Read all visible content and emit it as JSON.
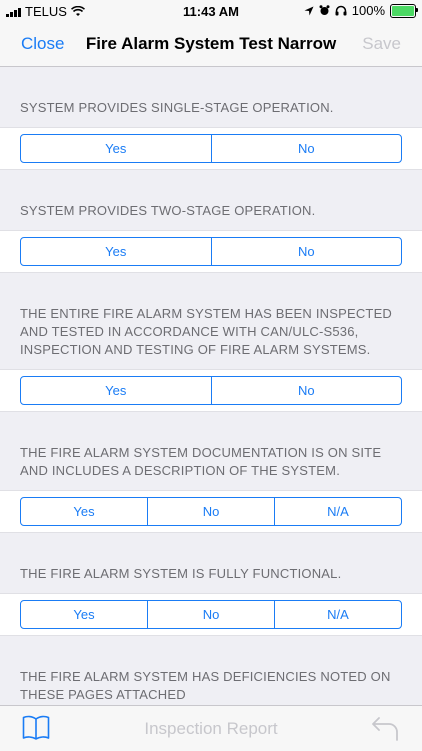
{
  "status": {
    "carrier": "TELUS",
    "time": "11:43 AM",
    "battery": "100%",
    "battery_level": 1.0
  },
  "nav": {
    "close_label": "Close",
    "title": "Fire Alarm System Test Narrow",
    "save_label": "Save"
  },
  "questions": [
    {
      "text": "SYSTEM PROVIDES SINGLE-STAGE OPERATION.",
      "options": [
        "Yes",
        "No"
      ]
    },
    {
      "text": "SYSTEM PROVIDES TWO-STAGE OPERATION.",
      "options": [
        "Yes",
        "No"
      ]
    },
    {
      "text": "THE ENTIRE FIRE ALARM SYSTEM HAS BEEN INSPECTED AND TESTED IN ACCORDANCE WITH CAN/ULC-S536, INSPECTION AND TESTING OF FIRE ALARM SYSTEMS.",
      "options": [
        "Yes",
        "No"
      ]
    },
    {
      "text": "THE FIRE ALARM SYSTEM DOCUMENTATION IS ON SITE AND INCLUDES A DESCRIPTION OF THE SYSTEM.",
      "options": [
        "Yes",
        "No",
        "N/A"
      ]
    },
    {
      "text": "THE FIRE ALARM SYSTEM IS FULLY FUNCTIONAL.",
      "options": [
        "Yes",
        "No",
        "N/A"
      ]
    },
    {
      "text": "THE FIRE ALARM SYSTEM HAS DEFICIENCIES NOTED ON THESE PAGES ATTACHED",
      "options": []
    }
  ],
  "tabbar": {
    "label": "Inspection Report"
  },
  "colors": {
    "accent": "#1a7cf5",
    "disabled": "#c7c7cc",
    "background": "#efeff4",
    "battery": "#4cd964"
  },
  "icons": {
    "left": "book-icon",
    "right": "undo-icon"
  }
}
